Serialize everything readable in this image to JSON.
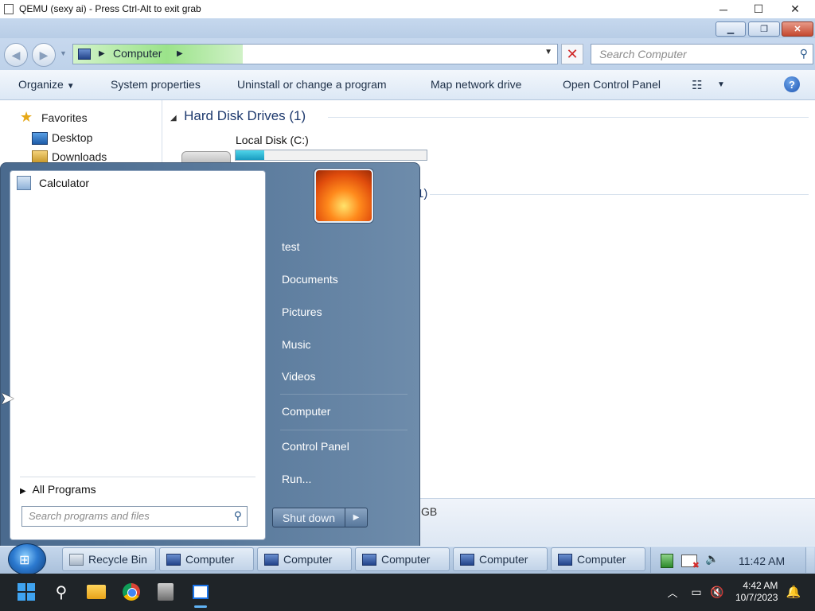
{
  "host_window": {
    "title": "QEMU (sexy ai) - Press Ctrl-Alt to exit grab",
    "controls": {
      "minimize": "─",
      "maximize": "☐",
      "close": "✕"
    }
  },
  "explorer": {
    "address": {
      "location": "Computer",
      "load_progress_pct": 35
    },
    "search_placeholder": "Search Computer",
    "commands": {
      "organize": "Organize",
      "system_properties": "System properties",
      "uninstall": "Uninstall or change a program",
      "map_network_drive": "Map network drive",
      "open_control_panel": "Open Control Panel"
    },
    "nav": {
      "favorites": "Favorites",
      "items": [
        "Desktop",
        "Downloads"
      ]
    },
    "groups": {
      "hard_disk_drives": "Hard Disk Drives (1)",
      "partial_count": "1)"
    },
    "drive": {
      "label": "Local Disk (C:)",
      "used_fraction": 0.15
    },
    "details_partial": "GB"
  },
  "start_menu": {
    "programs": [
      "Calculator"
    ],
    "all_programs": "All Programs",
    "search_placeholder": "Search programs and files",
    "right_items": {
      "user": "test",
      "documents": "Documents",
      "pictures": "Pictures",
      "music": "Music",
      "videos": "Videos",
      "computer": "Computer",
      "control_panel": "Control Panel",
      "run": "Run..."
    },
    "shutdown": "Shut down"
  },
  "guest_taskbar": {
    "buttons": [
      "Recycle Bin",
      "Computer",
      "Computer",
      "Computer",
      "Computer",
      "Computer"
    ],
    "clock": "11:42 AM"
  },
  "host_taskbar": {
    "time": "4:42 AM",
    "date": "10/7/2023"
  },
  "colors": {
    "accent": "#1e3a6e",
    "progress_fill": "#1a9cc0",
    "address_progress": "#9be38a"
  }
}
